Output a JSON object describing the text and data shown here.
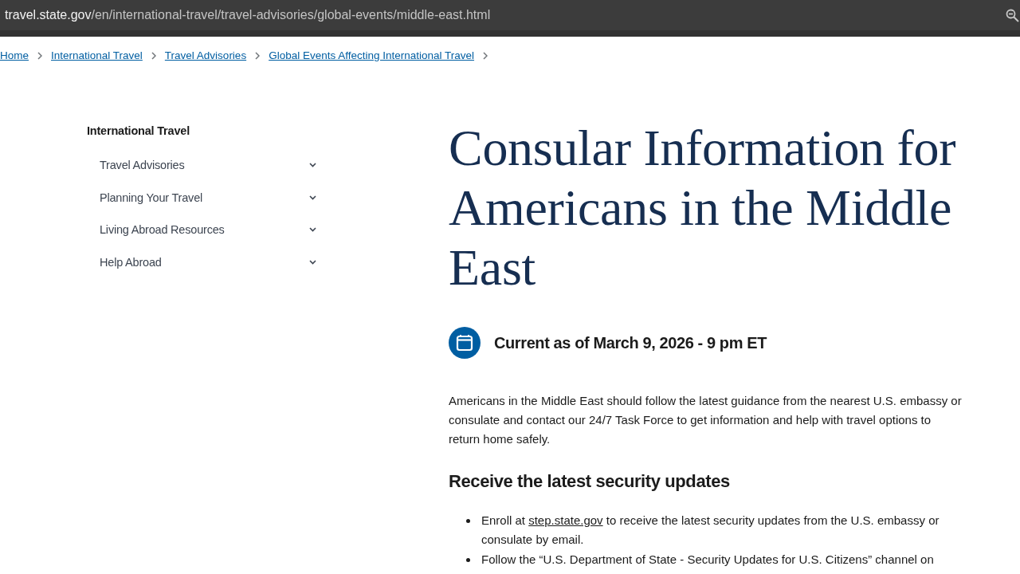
{
  "address_bar": {
    "host": "travel.state.gov",
    "path": "/en/international-travel/travel-advisories/global-events/middle-east.html"
  },
  "breadcrumbs": [
    "Home",
    "International Travel",
    "Travel Advisories",
    "Global Events Affecting International Travel"
  ],
  "sidebar": {
    "title": "International Travel",
    "items": [
      {
        "label": "Travel Advisories",
        "expanded": false
      },
      {
        "label": "Planning Your Travel",
        "expanded": false
      },
      {
        "label": "Living Abroad Resources",
        "expanded": false
      },
      {
        "label": "Help Abroad",
        "expanded": false
      }
    ]
  },
  "main": {
    "title": "Consular Information for Americans in the Middle East",
    "updated": "Current as of March 9, 2026 - 9 pm ET",
    "intro": "Americans in the Middle East should follow the latest guidance from the nearest U.S. embassy or consulate and contact our 24/7 Task Force to get information and help with travel options to return home safely.",
    "section_heading": "Receive the latest security updates",
    "bullets": [
      {
        "segments": [
          {
            "kind": "text",
            "text": "Enroll at "
          },
          {
            "kind": "link",
            "text": "step.state.gov"
          },
          {
            "kind": "text",
            "text": " to receive the latest security updates from the U.S. embassy or consulate by email."
          }
        ]
      },
      {
        "segments": [
          {
            "kind": "text",
            "text": "Follow the “U.S. Department of State - Security Updates for U.S. Citizens” channel on"
          }
        ]
      }
    ]
  }
}
